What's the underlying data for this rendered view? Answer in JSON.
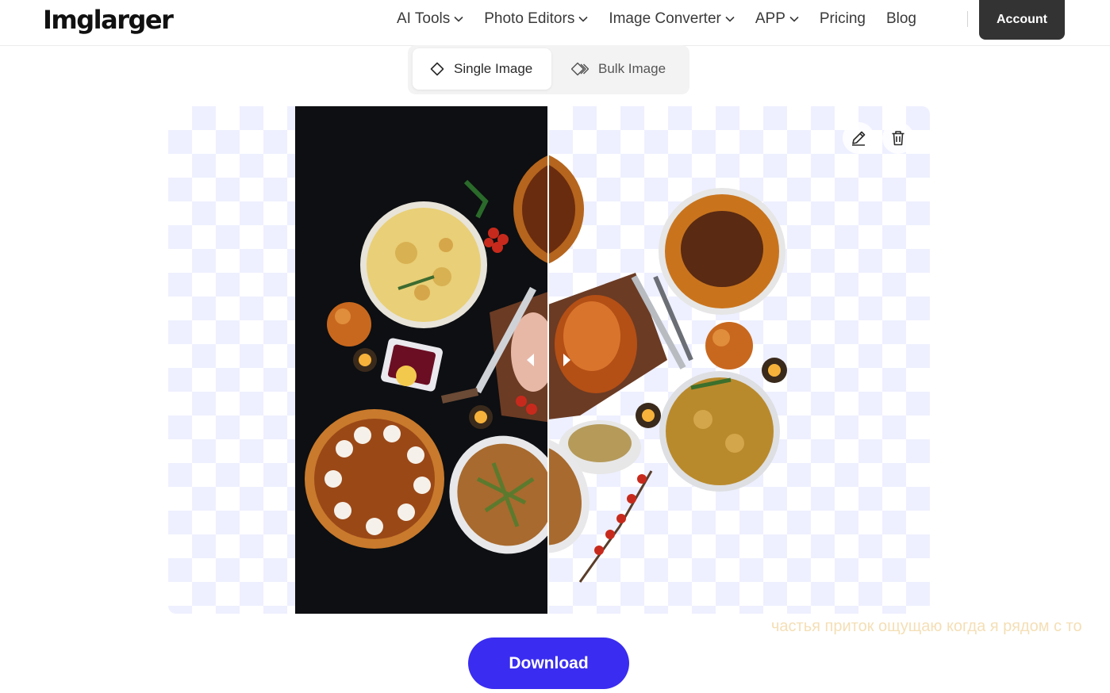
{
  "header": {
    "logo": "Imglarger",
    "nav": [
      {
        "label": "AI Tools",
        "dropdown": true
      },
      {
        "label": "Photo Editors",
        "dropdown": true
      },
      {
        "label": "Image Converter",
        "dropdown": true
      },
      {
        "label": "APP",
        "dropdown": true
      },
      {
        "label": "Pricing",
        "dropdown": false
      },
      {
        "label": "Blog",
        "dropdown": false
      }
    ],
    "account_label": "Account"
  },
  "tabs": {
    "single_label": "Single Image",
    "bulk_label": "Bulk Image",
    "active": "single"
  },
  "preview": {
    "edit_icon": "pencil-icon",
    "delete_icon": "trash-icon",
    "checker_color": "#eef0ff"
  },
  "overlay_text": "частья приток ощущаю когда я рядом с то",
  "download_label": "Download",
  "colors": {
    "accent": "#3a2cf0",
    "account_bg": "#333333"
  }
}
